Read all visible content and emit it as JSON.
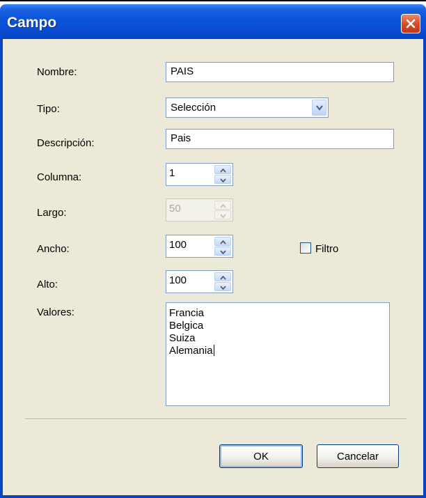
{
  "window": {
    "title": "Campo"
  },
  "fields": {
    "nombre": {
      "label": "Nombre:",
      "value": "PAIS"
    },
    "tipo": {
      "label": "Tipo:",
      "value": "Selección"
    },
    "descripcion": {
      "label": "Descripción:",
      "value": "Pais"
    },
    "columna": {
      "label": "Columna:",
      "value": "1"
    },
    "largo": {
      "label": "Largo:",
      "value": "50",
      "disabled": true
    },
    "ancho": {
      "label": "Ancho:",
      "value": "100"
    },
    "alto": {
      "label": "Alto:",
      "value": "100"
    },
    "filtro": {
      "label": "Filtro",
      "checked": false
    },
    "valores": {
      "label": "Valores:",
      "items": [
        "Francia",
        "Belgica",
        "Suiza",
        "Alemania"
      ]
    }
  },
  "buttons": {
    "ok": "OK",
    "cancel": "Cancelar"
  },
  "icons": {
    "close": "close-icon",
    "dropdown": "chevron-down-icon",
    "spin_up": "arrow-up-icon",
    "spin_down": "arrow-down-icon"
  },
  "colors": {
    "titlebar": "#0a55db",
    "dialog_bg": "#ece9d8",
    "close_button": "#d34a22"
  }
}
